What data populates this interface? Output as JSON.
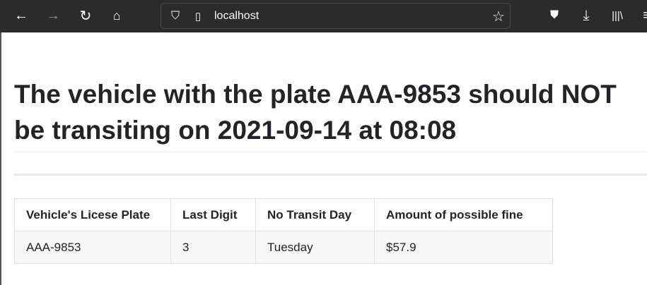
{
  "browser": {
    "url": "localhost",
    "icons": [
      "back-icon",
      "forward-icon",
      "reload-icon",
      "home-icon",
      "shield-icon",
      "page-icon",
      "star-icon",
      "pocket-icon",
      "download-icon",
      "library-icon",
      "menu-icon"
    ]
  },
  "heading": {
    "line1": "The vehicle with the plate AAA-9853 should NOT",
    "line2": "be transiting on 2021-09-14 at 08:08"
  },
  "table": {
    "headers": [
      "Vehicle's Licese Plate",
      "Last Digit",
      "No Transit Day",
      "Amount of possible fine"
    ],
    "rows": [
      [
        "AAA-9853",
        "3",
        "Tuesday",
        "$57.9"
      ]
    ]
  }
}
